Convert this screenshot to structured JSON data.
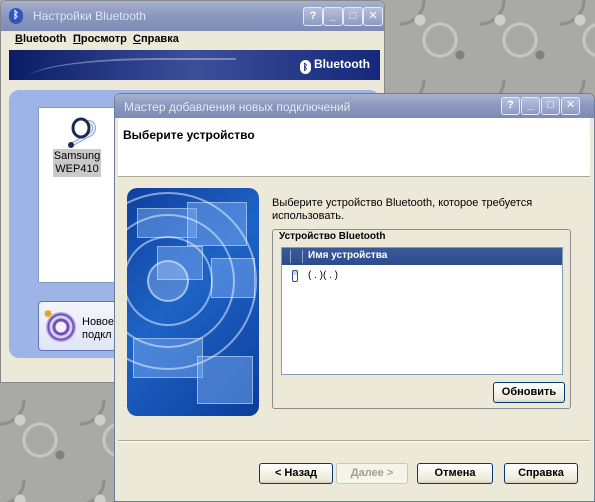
{
  "background_window": {
    "title": "Настройки Bluetooth",
    "controls": {
      "help": "?",
      "minimize": "_",
      "maximize": "□",
      "close": "✕"
    },
    "menu": [
      "Bluetooth",
      "Просмотр",
      "Справка"
    ],
    "banner_logo": "Bluetooth",
    "device": {
      "label_line1": "Samsung",
      "label_line2": "WEP410",
      "icon": "headset-icon"
    },
    "new_connection": {
      "label_line1": "Новое",
      "label_line2": "подкл",
      "icon": "new-connection-icon"
    }
  },
  "wizard": {
    "title": "Мастер добавления новых подключений",
    "controls": {
      "help": "?",
      "minimize": "_",
      "maximize": "□",
      "close": "✕"
    },
    "heading": "Выберите устройство",
    "prompt": "Выберите устройство Bluetooth, которое требуется использовать.",
    "group_title": "Устройство Bluetooth",
    "list": {
      "column_header": "Имя устройства",
      "rows": [
        {
          "name": "( . )( . )",
          "icon": "phone-icon"
        }
      ]
    },
    "buttons": {
      "refresh": "Обновить",
      "back": "< Назад",
      "next": "Далее >",
      "cancel": "Отмена",
      "help": "Справка"
    }
  },
  "colors": {
    "titlebar_inactive": "#8a97be",
    "dialog_face": "#ece9d8",
    "list_header": "#2e4c8c",
    "panel_blue": "#9fb4e6"
  }
}
